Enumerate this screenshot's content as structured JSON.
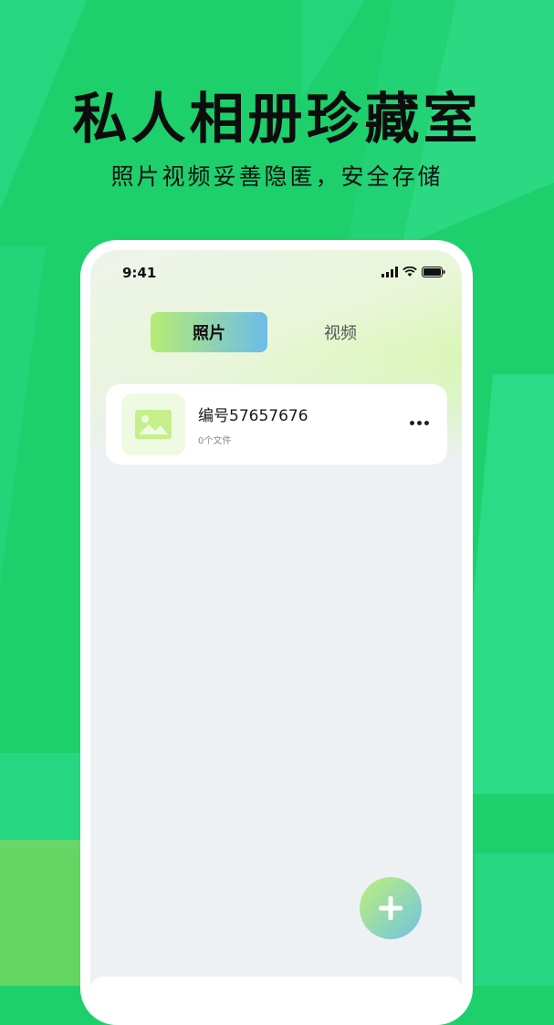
{
  "hero": {
    "title": "私人相册珍藏室",
    "subtitle": "照片视频妥善隐匿，安全存储"
  },
  "status_bar": {
    "time": "9:41"
  },
  "tabs": [
    {
      "label": "照片",
      "active": true
    },
    {
      "label": "视频",
      "active": false
    }
  ],
  "albums": [
    {
      "name": "编号57657676",
      "count": "0个文件",
      "icon": "image-icon"
    }
  ],
  "colors": {
    "background": "#1ed06c",
    "accent_green": "#b6ec72",
    "accent_blue": "#6cbcea"
  }
}
